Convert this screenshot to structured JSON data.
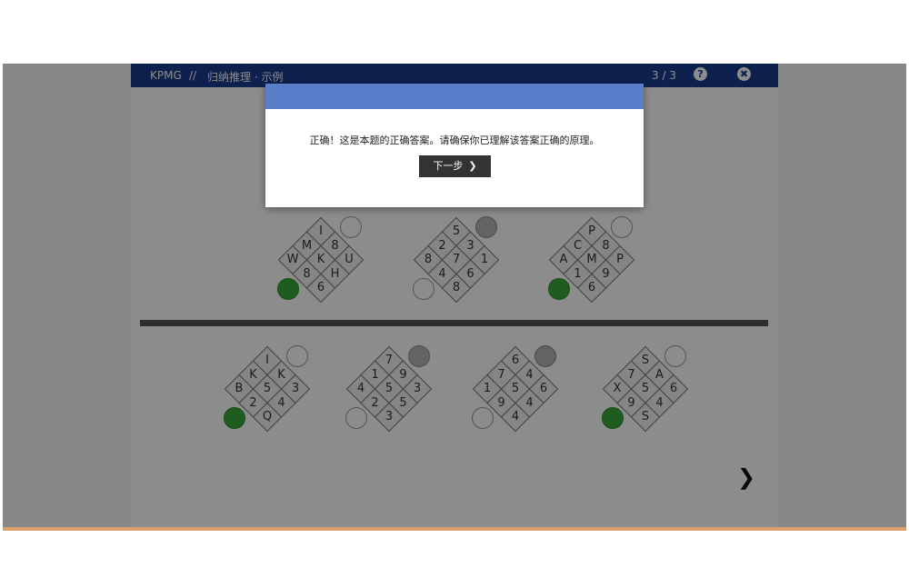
{
  "header": {
    "brand": "KPMG",
    "separator": "//",
    "breadcrumb": "归纳推理 · 示例",
    "progress": "3 / 3",
    "help_icon": "?",
    "close_icon": "✖"
  },
  "modal": {
    "message": "正确！这是本题的正确答案。请确保你已理解该答案正确的原理。",
    "next_label": "下一步",
    "next_icon": "❯"
  },
  "navigation": {
    "next_arrow_icon": "❯"
  },
  "colors": {
    "header_bg": "#1b3d8f",
    "modal_header": "#5a7ec9",
    "button_bg": "#333333",
    "green_dot": "#3aa83a",
    "divider": "#555555"
  },
  "question_pieces": [
    {
      "cells": [
        "I",
        "M",
        "W",
        "8",
        "K",
        "8",
        "U",
        "H",
        "6"
      ],
      "top_dot": "empty",
      "bottom_dot": "green"
    },
    {
      "cells": [
        "5",
        "2",
        "8",
        "3",
        "7",
        "4",
        "1",
        "6",
        "8"
      ],
      "top_dot": "gray",
      "bottom_dot": "empty"
    },
    {
      "cells": [
        "P",
        "C",
        "A",
        "8",
        "M",
        "1",
        "P",
        "9",
        "6"
      ],
      "top_dot": "empty",
      "bottom_dot": "green"
    }
  ],
  "answer_pieces": [
    {
      "cells": [
        "I",
        "K",
        "B",
        "K",
        "5",
        "2",
        "3",
        "4",
        "Q"
      ],
      "top_dot": "empty",
      "bottom_dot": "green"
    },
    {
      "cells": [
        "7",
        "1",
        "4",
        "9",
        "5",
        "2",
        "3",
        "5",
        "3"
      ],
      "top_dot": "gray",
      "bottom_dot": "empty"
    },
    {
      "cells": [
        "6",
        "7",
        "1",
        "4",
        "5",
        "9",
        "6",
        "4",
        "4"
      ],
      "top_dot": "gray",
      "bottom_dot": "empty"
    },
    {
      "cells": [
        "S",
        "7",
        "X",
        "A",
        "5",
        "9",
        "6",
        "4",
        "S"
      ],
      "top_dot": "empty",
      "bottom_dot": "green"
    }
  ]
}
